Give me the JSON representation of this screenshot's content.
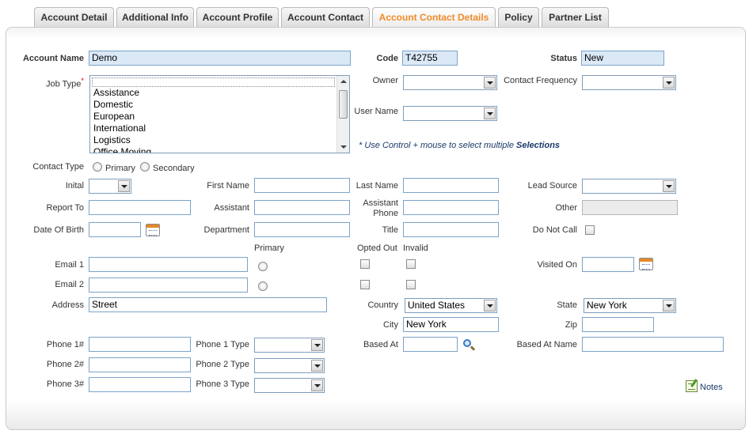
{
  "tabs": [
    {
      "label": "Account Detail"
    },
    {
      "label": "Additional Info"
    },
    {
      "label": "Account Profile"
    },
    {
      "label": "Account Contact"
    },
    {
      "label": "Account Contact Details",
      "active": true
    },
    {
      "label": "Policy"
    },
    {
      "label": "Partner List"
    }
  ],
  "colors": {
    "active_tab": "#f28c28",
    "input_border": "#7ba3c9",
    "filled_bg": "#dbe9f7",
    "required": "#dd0000"
  },
  "form": {
    "account_name": {
      "label": "Account Name",
      "value": "Demo"
    },
    "code": {
      "label": "Code",
      "value": "T42755"
    },
    "status": {
      "label": "Status",
      "value": "New"
    },
    "job_type": {
      "label": "Job Type",
      "required_mark": "*",
      "options": [
        "Assistance",
        "Domestic",
        "European",
        "International",
        "Logistics",
        "Office Moving"
      ]
    },
    "owner": {
      "label": "Owner",
      "value": ""
    },
    "contact_frequency": {
      "label": "Contact Frequency",
      "value": ""
    },
    "user_name": {
      "label": "User Name",
      "value": ""
    },
    "selection_hint": {
      "text": "* Use Control + mouse to select multiple",
      "emphasis": "Selections"
    },
    "contact_type": {
      "label": "Contact Type",
      "options": [
        "Primary",
        "Secondary"
      ]
    },
    "initial": {
      "label": "Inital",
      "value": ""
    },
    "first_name": {
      "label": "First Name",
      "value": ""
    },
    "last_name": {
      "label": "Last Name",
      "value": ""
    },
    "lead_source": {
      "label": "Lead Source",
      "value": ""
    },
    "report_to": {
      "label": "Report To",
      "value": ""
    },
    "assistant": {
      "label": "Assistant",
      "value": ""
    },
    "assistant_phone": {
      "label_line1": "Assistant",
      "label_line2": "Phone",
      "value": ""
    },
    "other": {
      "label": "Other",
      "value": ""
    },
    "date_of_birth": {
      "label": "Date Of Birth",
      "value": ""
    },
    "department": {
      "label": "Department",
      "value": ""
    },
    "title": {
      "label": "Title",
      "value": ""
    },
    "do_not_call": {
      "label": "Do Not Call",
      "checked": false
    },
    "email_headers": {
      "primary": "Primary",
      "opted_out": "Opted Out",
      "invalid": "Invalid"
    },
    "email1": {
      "label": "Email 1",
      "value": ""
    },
    "email2": {
      "label": "Email 2",
      "value": ""
    },
    "visited_on": {
      "label": "Visited On",
      "value": ""
    },
    "address": {
      "label": "Address",
      "value": "Street"
    },
    "country": {
      "label": "Country",
      "value": "United States"
    },
    "state": {
      "label": "State",
      "value": "New York"
    },
    "city": {
      "label": "City",
      "value": "New York"
    },
    "zip": {
      "label": "Zip",
      "value": ""
    },
    "phone1": {
      "label": "Phone 1#",
      "value": "",
      "type_label": "Phone 1 Type",
      "type_value": ""
    },
    "phone2": {
      "label": "Phone 2#",
      "value": "",
      "type_label": "Phone 2 Type",
      "type_value": ""
    },
    "phone3": {
      "label": "Phone 3#",
      "value": "",
      "type_label": "Phone 3 Type",
      "type_value": ""
    },
    "based_at": {
      "label": "Based At",
      "value": ""
    },
    "based_at_name": {
      "label": "Based At Name",
      "value": ""
    },
    "notes": {
      "label": "Notes"
    }
  }
}
